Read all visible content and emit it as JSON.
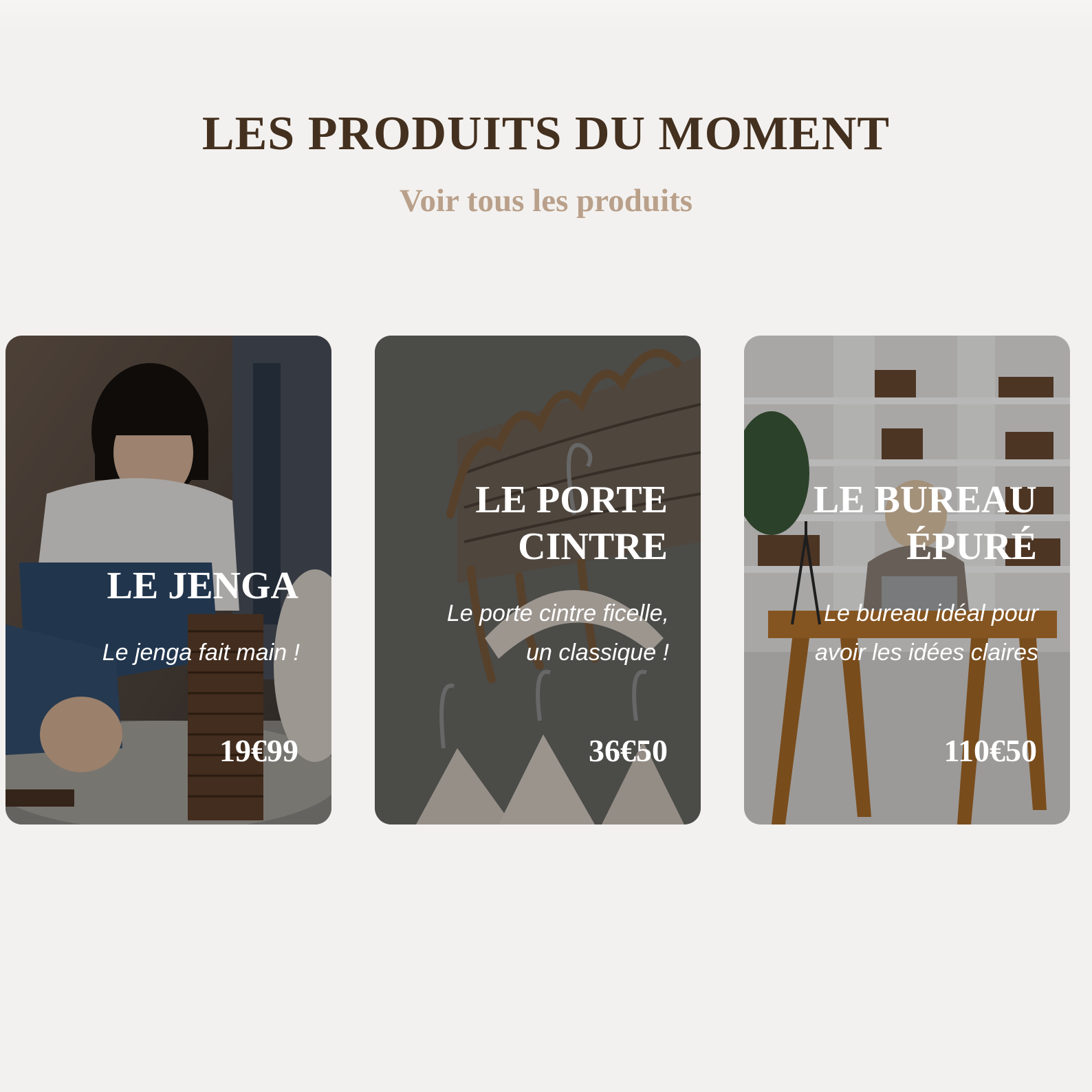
{
  "section": {
    "title": "LES PRODUITS DU MOMENT",
    "see_all_label": "Voir tous les produits"
  },
  "products": [
    {
      "name": "LE JENGA",
      "description": "Le jenga fait main !",
      "price": "19€99",
      "image_icon": "child-playing-jenga-photo"
    },
    {
      "name": "LE PORTE\nCINTRE",
      "description": "Le porte cintre ficelle,\nun classique !",
      "price": "36€50",
      "image_icon": "coat-hanger-rack-photo"
    },
    {
      "name": "LE BUREAU\nÉPURÉ",
      "description": "Le bureau idéal pour\navoir les idées claires",
      "price": "110€50",
      "image_icon": "woman-at-desk-photo"
    }
  ],
  "colors": {
    "background": "#f3f1ef",
    "heading": "#44301f",
    "link": "#b9a08a"
  }
}
